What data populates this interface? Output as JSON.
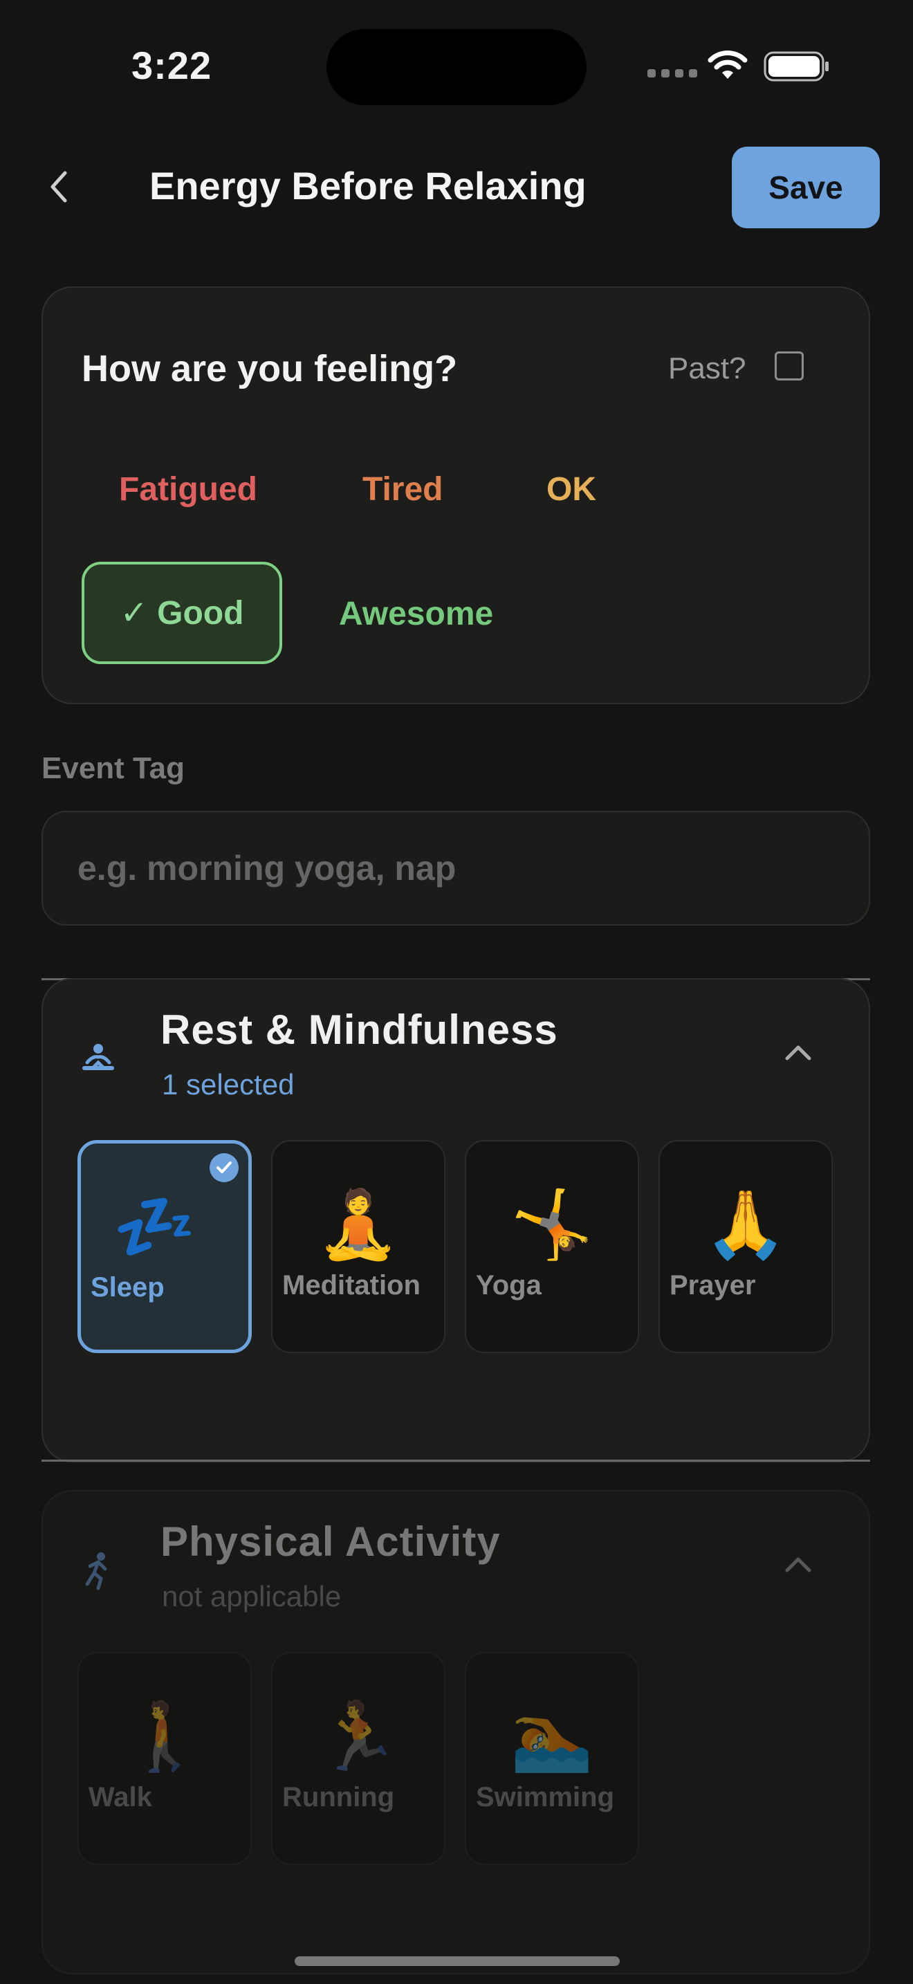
{
  "status_bar": {
    "time": "3:22"
  },
  "nav": {
    "title": "Energy Before Relaxing",
    "save_label": "Save"
  },
  "feeling": {
    "question": "How are you feeling?",
    "past_label": "Past?",
    "past_checked": false,
    "moods": [
      {
        "label": "Fatigued",
        "color": "#e06060"
      },
      {
        "label": "Tired",
        "color": "#e07f4e"
      },
      {
        "label": "OK",
        "color": "#e5b057"
      },
      {
        "label": "✓ Good",
        "color": "#8fd895",
        "selected": true
      },
      {
        "label": "Awesome",
        "color": "#75c97c"
      }
    ]
  },
  "event_tag": {
    "label": "Event Tag",
    "placeholder": "e.g. morning yoga, nap",
    "value": ""
  },
  "categories": [
    {
      "title": "Rest & Mindfulness",
      "subtitle": "1 selected",
      "icon": "meditation-icon",
      "expanded": true,
      "items": [
        {
          "label": "Sleep",
          "emoji": "💤",
          "selected": true
        },
        {
          "label": "Meditation",
          "emoji": "🧘",
          "selected": false
        },
        {
          "label": "Yoga",
          "emoji": "🤸",
          "selected": false
        },
        {
          "label": "Prayer",
          "emoji": "🙏",
          "selected": false
        }
      ]
    },
    {
      "title": "Physical Activity",
      "subtitle": "not applicable",
      "icon": "running-icon",
      "expanded": true,
      "disabled": true,
      "items": [
        {
          "label": "Walk",
          "emoji": "🚶",
          "selected": false
        },
        {
          "label": "Running",
          "emoji": "🏃",
          "selected": false
        },
        {
          "label": "Swimming",
          "emoji": "🏊",
          "selected": false
        }
      ]
    }
  ],
  "colors": {
    "accent": "#6ea3de",
    "background": "#141414",
    "card": "#1d1e1c"
  }
}
